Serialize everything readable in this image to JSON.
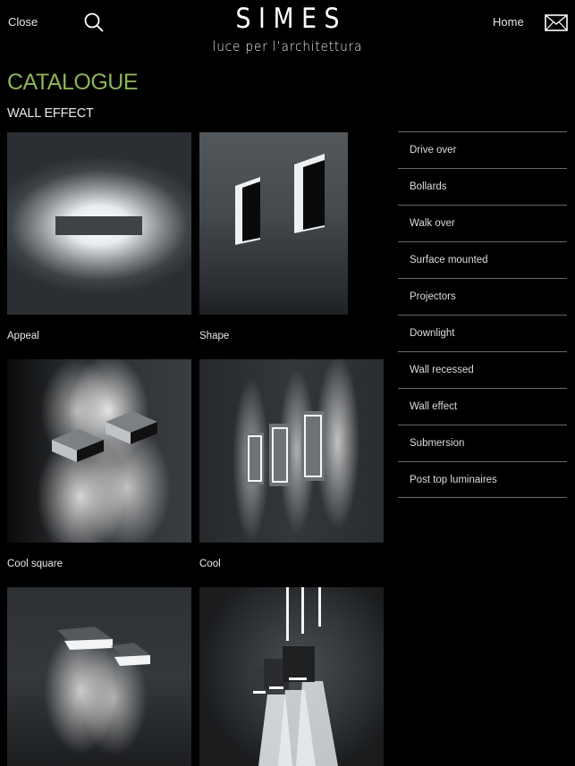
{
  "header": {
    "close_label": "Close",
    "home_label": "Home",
    "logo_main": "SIMES",
    "logo_tagline": "luce per l’architettura",
    "icons": {
      "search": "search-icon",
      "mail": "mail-icon"
    }
  },
  "page": {
    "title": "CATALOGUE",
    "subtitle": "WALL EFFECT",
    "accent_color": "#8db35a"
  },
  "products": [
    {
      "name": "Appeal"
    },
    {
      "name": "Shape"
    },
    {
      "name": "Cool square"
    },
    {
      "name": "Cool"
    },
    {
      "name": ""
    },
    {
      "name": ""
    }
  ],
  "categories": [
    {
      "label": "Drive over"
    },
    {
      "label": "Bollards"
    },
    {
      "label": "Walk over"
    },
    {
      "label": "Surface mounted"
    },
    {
      "label": "Projectors"
    },
    {
      "label": "Downlight"
    },
    {
      "label": "Wall recessed"
    },
    {
      "label": "Wall effect"
    },
    {
      "label": "Submersion"
    },
    {
      "label": "Post top luminaires"
    }
  ]
}
